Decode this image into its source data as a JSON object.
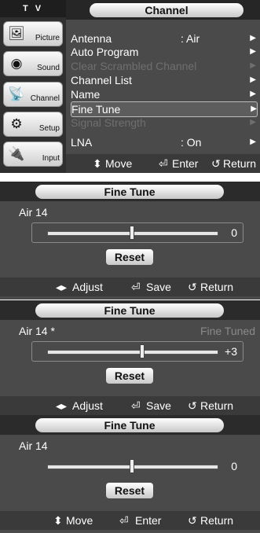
{
  "channel_menu": {
    "tv_label": "T V",
    "title": "Channel",
    "sidebar": [
      {
        "label": "Picture",
        "icon": "picture-icon"
      },
      {
        "label": "Sound",
        "icon": "sound-icon"
      },
      {
        "label": "Channel",
        "icon": "channel-icon"
      },
      {
        "label": "Setup",
        "icon": "setup-icon"
      },
      {
        "label": "Input",
        "icon": "input-icon"
      }
    ],
    "items": [
      {
        "name": "Antenna",
        "value": ": Air"
      },
      {
        "name": "Auto Program",
        "value": ""
      },
      {
        "name": "Clear Scrambled Channel",
        "value": ""
      },
      {
        "name": "Channel List",
        "value": ""
      },
      {
        "name": "Name",
        "value": ""
      },
      {
        "name": "Fine Tune",
        "value": ""
      },
      {
        "name": "Signal Strength",
        "value": ""
      },
      {
        "name": "LNA",
        "value": ": On"
      }
    ],
    "footer": {
      "move": "Move",
      "enter": "Enter",
      "return": "Return"
    }
  },
  "panels": [
    {
      "title": "Fine Tune",
      "channel": "Air 14",
      "status": "",
      "value": "0",
      "level": 0.5,
      "reset_label": "Reset",
      "footer": {
        "a": "Adjust",
        "b": "Save",
        "c": "Return"
      }
    },
    {
      "title": "Fine Tune",
      "channel": "Air 14 *",
      "status": "Fine Tuned",
      "value": "+3",
      "level": 0.56,
      "reset_label": "Reset",
      "footer": {
        "a": "Adjust",
        "b": "Save",
        "c": "Return"
      }
    },
    {
      "title": "Fine Tune",
      "channel": "Air 14",
      "status": "",
      "value": "0",
      "level": 0.5,
      "reset_label": "Reset",
      "footer": {
        "a": "Move",
        "b": "Enter",
        "c": "Return"
      }
    }
  ],
  "colors": {
    "panel_bg": "#4a4a4a",
    "title_bg": "#262626",
    "dim_text": "#6f6f6f"
  }
}
